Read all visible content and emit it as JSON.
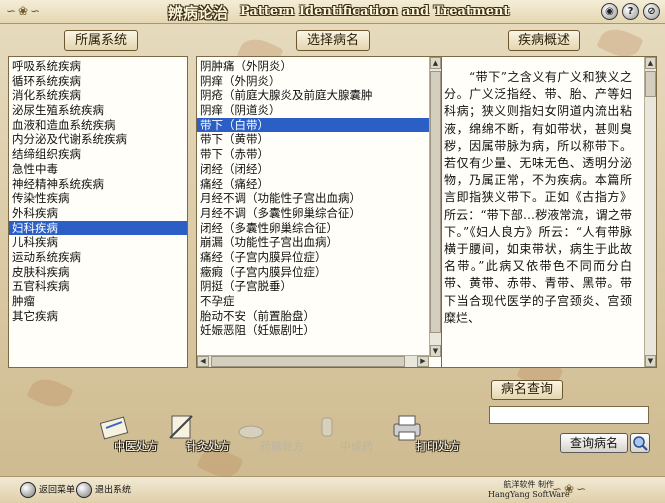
{
  "app": {
    "title_cn": "辨病论治",
    "title_en": "Pattern Identification and Treatment",
    "deco_left": "∽❀∽",
    "deco_right": "∽❀∽",
    "win_buttons": [
      "◉",
      "?",
      "⊘"
    ]
  },
  "headers": {
    "category": "所属系统",
    "disease": "选择病名",
    "overview": "疾病概述",
    "search": "病名查询"
  },
  "categories": [
    "呼吸系统疾病",
    "循环系统疾病",
    "消化系统疾病",
    "泌尿生殖系统疾病",
    "血液和造血系统疾病",
    "内分泌及代谢系统疾病",
    "结缔组织疾病",
    "急性中毒",
    "神经精神系统疾病",
    "传染性疾病",
    "外科疾病",
    "妇科疾病",
    "儿科疾病",
    "运动系统疾病",
    "皮肤科疾病",
    "五官科疾病",
    "肿瘤",
    "其它疾病"
  ],
  "selected_category": 11,
  "diseases": [
    "阴肿痛（外阴炎）",
    "阴痒（外阴炎）",
    "阴疮（前庭大腺炎及前庭大腺囊肿",
    "阴痒（阴道炎）",
    "带下（白带）",
    "带下（黄带）",
    "带下（赤带）",
    "闭经（闭经）",
    "痛经（痛经）",
    "月经不调（功能性子宫出血病）",
    "月经不调（多囊性卵巢综合征）",
    "闭经（多囊性卵巢综合征）",
    "崩漏（功能性子宫出血病）",
    "痛经（子宫内膜异位症）",
    "癥瘕（子宫内膜异位症）",
    "阴挺（子宫脱垂）",
    "不孕症",
    "胎动不安（前置胎盘）",
    "妊娠恶阻（妊娠剧吐）"
  ],
  "selected_disease": 4,
  "overview_text": "　　“带下”之含义有广义和狭义之分。广义泛指经、带、胎、产等妇科病；狭义则指妇女阴道内流出粘液，绵绵不断，有如带状，甚则臭秽，因属带脉为病，所以称带下。若仅有少量、无味无色、透明分泌物，乃属正常，不为疾病。本篇所言即指狭义带下。正如《古指方》所云：“带下部…秽液常流，谓之带下。”《妇人良方》所云：“人有带脉横于腰间，如束带状，病生于此故名带。”此病又依带色不同而分白带、黄带、赤带、青带、黑带。带下当合现代医学的子宫颈炎、宫颈糜烂、",
  "tools": {
    "prescription": "中医处方",
    "acupuncture": "针灸处方",
    "diet": "药膳处方",
    "patent": "中成药",
    "print": "打印处方"
  },
  "search": {
    "input_value": "",
    "button": "查询病名"
  },
  "footer": {
    "back_menu": "返回菜单",
    "exit": "退出系统",
    "credit_line1": "航洋软件 制作",
    "credit_line2": "HangYang SoftWare"
  }
}
